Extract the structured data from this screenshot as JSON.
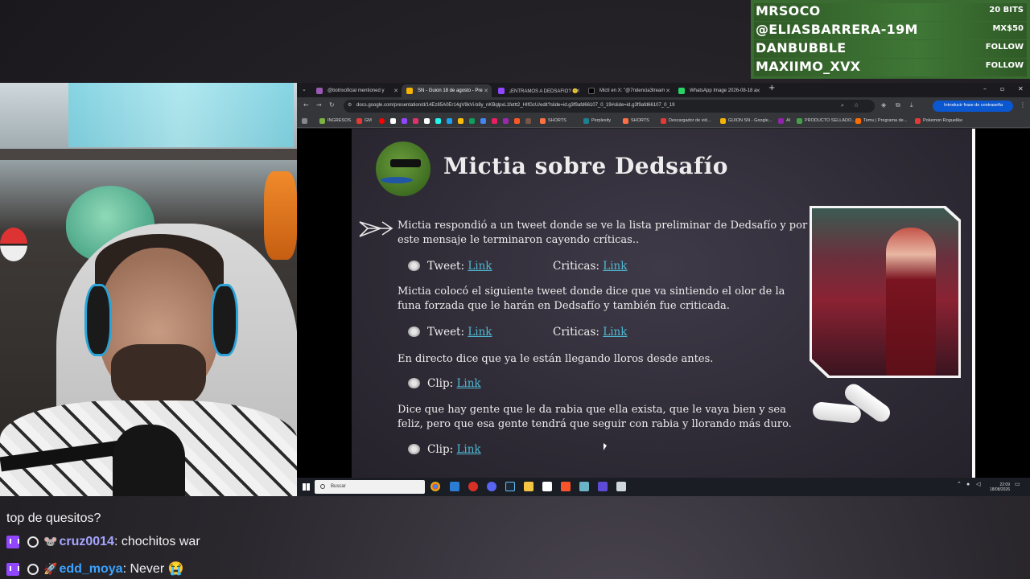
{
  "alerts": [
    {
      "name": "MRSOCO",
      "value": "20 BITS"
    },
    {
      "name": "@ELIASBARRERA-19M",
      "value": "MX$50"
    },
    {
      "name": "DANBUBBLE",
      "value": "FOLLOW"
    },
    {
      "name": "MAXIIMO_XVX",
      "value": "FOLLOW"
    }
  ],
  "chat": {
    "partial_line": "top de quesitos?",
    "messages": [
      {
        "user": "cruz0014",
        "text": "chochitos war",
        "user_color": "#a6a6ff"
      },
      {
        "user": "edd_moya",
        "text": "Never 😭",
        "user_color": "#3aa3ff"
      }
    ]
  },
  "browser": {
    "tabs": [
      {
        "label": "@botrixoficial mentioned y",
        "color": "#9b59b6"
      },
      {
        "label": "SN - Guion 18 de agosto - Pre",
        "color": "#f4b400"
      },
      {
        "label": "¡ENTRAMOS A DEDSAFIO? 🙂",
        "color": "#9146ff"
      },
      {
        "label": "Mictí en X: \"@7ndencia3tream",
        "color": "#111111"
      },
      {
        "label": "WhatsApp Image 2026-08-18 a",
        "color": "#25d366"
      }
    ],
    "url": "docs.google.com/presentation/d/14Ez85A0Er14gV9kVi-b8y_nKBqlpxL1fettt2_HIfGcU/edit?slide=id.g3f9afd66107_0_19#slide=id.g3f9afd66107_0_19",
    "password_suggest": "Introducir frase de contraseña",
    "bookmarks": [
      {
        "label": "INGRESOS",
        "color": "#7cb342"
      },
      {
        "label": "GM",
        "color": "#e53935"
      },
      {
        "label": "SHORTS",
        "color": "#ff7043"
      },
      {
        "label": "Perplexity",
        "color": "#20808d"
      },
      {
        "label": "SHORTS",
        "color": "#ff7043"
      },
      {
        "label": "Descargador de vid...",
        "color": "#e53935"
      },
      {
        "label": "GUION SN - Google...",
        "color": "#f4b400"
      },
      {
        "label": "AI",
        "color": "#8e24aa"
      },
      {
        "label": "PRODUCTO SELLADO...",
        "color": "#43a047"
      },
      {
        "label": "Temu | Programa de...",
        "color": "#ff6d00"
      },
      {
        "label": "Pokemon Roguelike",
        "color": "#e53935"
      }
    ]
  },
  "slide": {
    "title": "Mictia sobre Dedsafío",
    "p1": "Mictia respondió a un tweet donde se ve la lista preliminar de Dedsafío y por este mensaje le terminaron cayendo críticas..",
    "p2": "Mictia colocó el siguiente tweet donde dice que va sintiendo el olor de la funa forzada que le harán en Dedsafío y también fue criticada.",
    "p3": "En directo dice que ya le están llegando lloros desde antes.",
    "p4": "Dice que hay gente que le da rabia que ella exista, que le vaya bien y sea feliz, pero que esa gente tendrá que seguir con rabia y llorando más duro.",
    "tweet_label": "Tweet:",
    "criticas_label": "Criticas:",
    "clip_label": "Clip:",
    "link_text": "Link"
  },
  "taskbar": {
    "search_placeholder": "Buscar",
    "time": "22:09",
    "date": "18/08/2026"
  }
}
